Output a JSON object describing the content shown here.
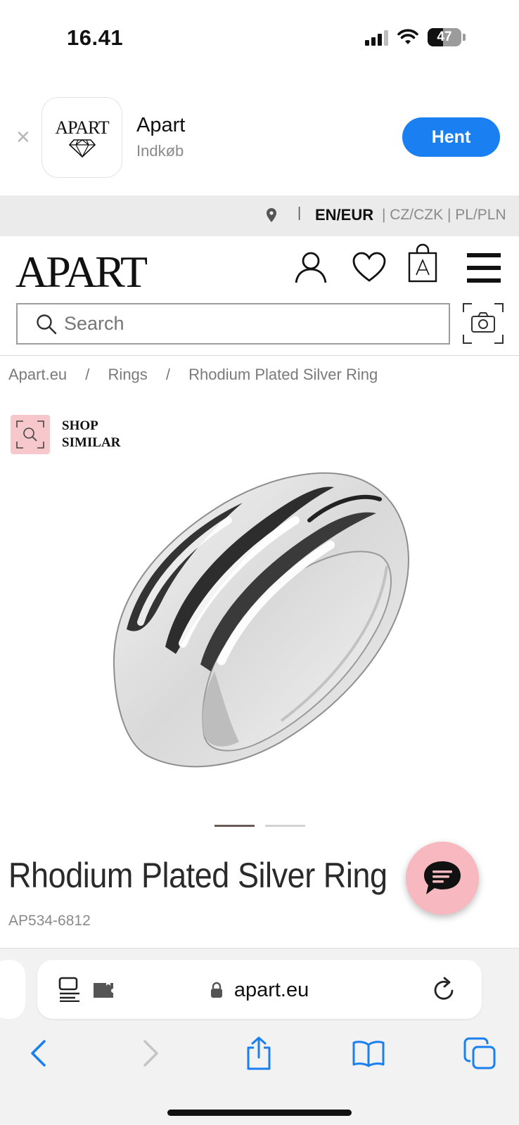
{
  "status_bar": {
    "time": "16.41",
    "battery_level": "47"
  },
  "app_banner": {
    "icon_text": "APART",
    "app_name": "Apart",
    "category": "Indkøb",
    "get_button": "Hent"
  },
  "locale": {
    "current": "EN/EUR",
    "others": "| CZ/CZK | PL/PLN"
  },
  "header": {
    "logo": "APART",
    "search_placeholder": "Search"
  },
  "breadcrumb": {
    "items": [
      "Apart.eu",
      "Rings",
      "Rhodium Plated Silver Ring"
    ],
    "separator": "/"
  },
  "shop_similar": {
    "line1": "SHOP",
    "line2": "SIMILAR"
  },
  "carousel": {
    "active_color": "#6b5a55",
    "inactive_color": "#d3d3d3",
    "active_index": 0,
    "count": 2
  },
  "product": {
    "title": "Rhodium Plated Silver Ring",
    "sku": "AP534-6812"
  },
  "browser": {
    "url": "apart.eu"
  },
  "colors": {
    "accent_blue": "#1a7ff0",
    "chat_pink": "#f7b9bf",
    "shop_similar_pink": "#f6c7cb"
  }
}
